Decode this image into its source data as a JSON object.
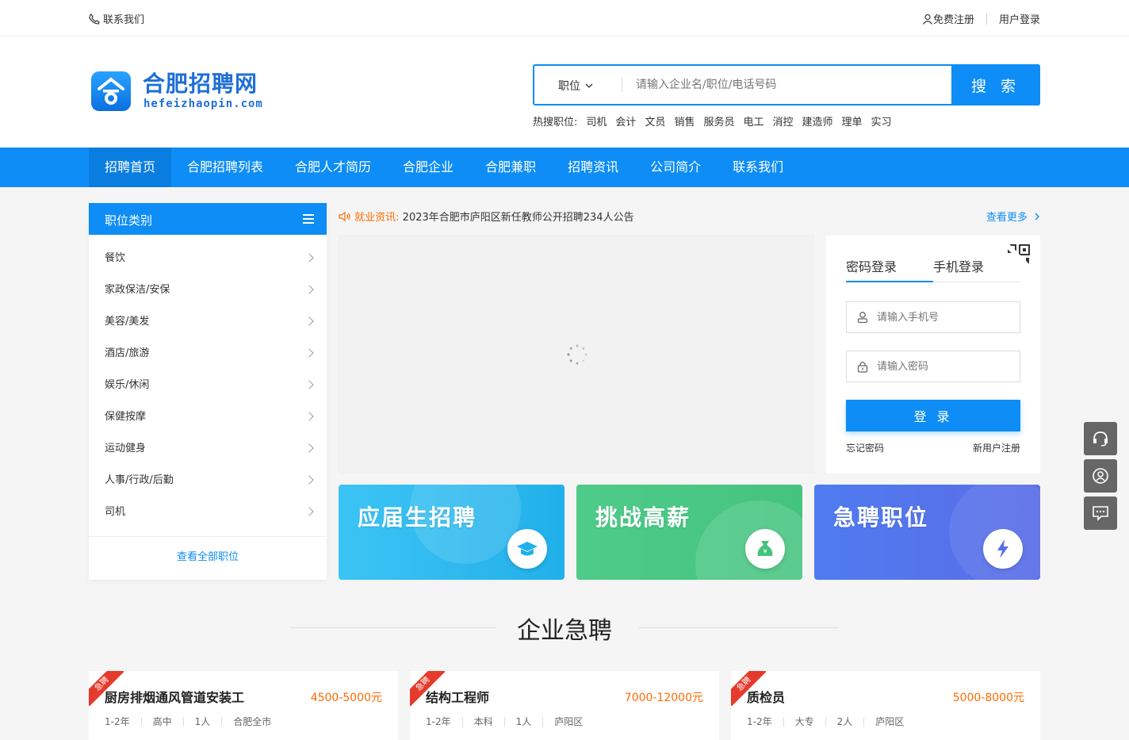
{
  "topbar": {
    "contact": "联系我们",
    "register": "免费注册",
    "login": "用户登录"
  },
  "logo": {
    "title": "合肥招聘网",
    "subtitle": "hefeizhaopin.com"
  },
  "search": {
    "type": "职位",
    "placeholder": "请输入企业名/职位/电话号码",
    "button": "搜 索"
  },
  "hot": {
    "label": "热搜职位:",
    "items": [
      "司机",
      "会计",
      "文员",
      "销售",
      "服务员",
      "电工",
      "消控",
      "建造师",
      "理单",
      "实习"
    ]
  },
  "nav": {
    "items": [
      "招聘首页",
      "合肥招聘列表",
      "合肥人才简历",
      "合肥企业",
      "合肥兼职",
      "招聘资讯",
      "公司简介",
      "联系我们"
    ],
    "active": 0
  },
  "sidebar": {
    "title": "职位类别",
    "items": [
      "餐饮",
      "家政保洁/安保",
      "美容/美发",
      "酒店/旅游",
      "娱乐/休闲",
      "保健按摩",
      "运动健身",
      "人事/行政/后勤",
      "司机"
    ],
    "more": "查看全部职位"
  },
  "news": {
    "label": "就业资讯:",
    "text": "2023年合肥市庐阳区新任教师公开招聘234人公告",
    "more": "查看更多"
  },
  "login": {
    "tab_password": "密码登录",
    "tab_phone": "手机登录",
    "phone_placeholder": "请输入手机号",
    "password_placeholder": "请输入密码",
    "button": "登 录",
    "forgot": "忘记密码",
    "register": "新用户注册"
  },
  "promos": [
    {
      "title": "应届生招聘",
      "icon": "graduation-cap-icon",
      "color": "#21b0ea"
    },
    {
      "title": "挑战高薪",
      "icon": "money-bag-icon",
      "color": "#44c37e"
    },
    {
      "title": "急聘职位",
      "icon": "lightning-icon",
      "color": "#5b6de8"
    }
  ],
  "section": {
    "title": "企业急聘"
  },
  "jobs": [
    {
      "tag": "急聘",
      "name": "厨房排烟通风管道安装工",
      "salary": "4500-5000元",
      "meta": [
        "1-2年",
        "高中",
        "1人",
        "合肥全市"
      ]
    },
    {
      "tag": "急聘",
      "name": "结构工程师",
      "salary": "7000-12000元",
      "meta": [
        "1-2年",
        "本科",
        "1人",
        "庐阳区"
      ]
    },
    {
      "tag": "急聘",
      "name": "质检员",
      "salary": "5000-8000元",
      "meta": [
        "1-2年",
        "大专",
        "2人",
        "庐阳区"
      ]
    }
  ],
  "colors": {
    "primary": "#0d8df5",
    "accent": "#ff6a00",
    "urgent": "#e53b2c"
  }
}
